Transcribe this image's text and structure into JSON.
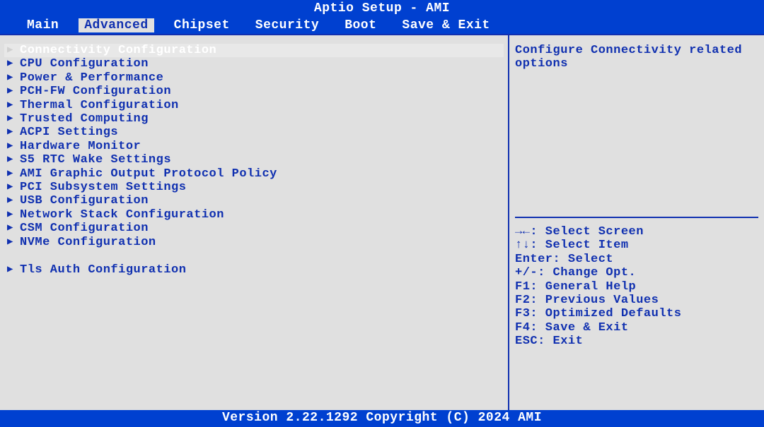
{
  "title": "Aptio Setup - AMI",
  "tabs": [
    {
      "label": "Main",
      "active": false
    },
    {
      "label": "Advanced",
      "active": true
    },
    {
      "label": "Chipset",
      "active": false
    },
    {
      "label": "Security",
      "active": false
    },
    {
      "label": "Boot",
      "active": false
    },
    {
      "label": "Save & Exit",
      "active": false
    }
  ],
  "menu_items": [
    {
      "label": "Connectivity Configuration",
      "selected": true
    },
    {
      "label": "CPU Configuration",
      "selected": false
    },
    {
      "label": "Power & Performance",
      "selected": false
    },
    {
      "label": "PCH-FW Configuration",
      "selected": false
    },
    {
      "label": "Thermal Configuration",
      "selected": false
    },
    {
      "label": "Trusted Computing",
      "selected": false
    },
    {
      "label": "ACPI Settings",
      "selected": false
    },
    {
      "label": "Hardware Monitor",
      "selected": false
    },
    {
      "label": "S5 RTC Wake Settings",
      "selected": false
    },
    {
      "label": "AMI Graphic Output Protocol Policy",
      "selected": false
    },
    {
      "label": "PCI Subsystem Settings",
      "selected": false
    },
    {
      "label": "USB Configuration",
      "selected": false
    },
    {
      "label": "Network Stack Configuration",
      "selected": false
    },
    {
      "label": "CSM Configuration",
      "selected": false
    },
    {
      "label": "NVMe Configuration",
      "selected": false
    },
    {
      "label": "",
      "selected": false,
      "blank": true
    },
    {
      "label": "Tls Auth Configuration",
      "selected": false
    }
  ],
  "help_text": "Configure Connectivity related options",
  "legend": [
    "→←: Select Screen",
    "↑↓: Select Item",
    "Enter: Select",
    "+/-: Change Opt.",
    "F1: General Help",
    "F2: Previous Values",
    "F3: Optimized Defaults",
    "F4: Save & Exit",
    "ESC: Exit"
  ],
  "footer": "Version 2.22.1292 Copyright (C) 2024 AMI"
}
